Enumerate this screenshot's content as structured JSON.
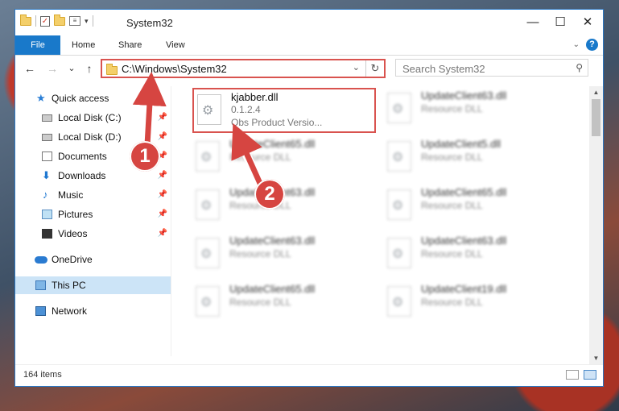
{
  "window": {
    "title": "System32",
    "controls": {
      "minimize": "—",
      "maximize": "☐",
      "close": "✕"
    }
  },
  "ribbon": {
    "tabs": [
      {
        "label": "File"
      },
      {
        "label": "Home"
      },
      {
        "label": "Share"
      },
      {
        "label": "View"
      }
    ],
    "help": "?"
  },
  "nav": {
    "back": "←",
    "forward": "→",
    "recent": "⌄",
    "up": "↑",
    "address": "C:\\Windows\\System32",
    "refresh": "↻",
    "search_placeholder": "Search System32"
  },
  "sidebar": {
    "items": [
      {
        "label": "Quick access",
        "icon": "star-icon"
      },
      {
        "label": "Local Disk (C:)",
        "icon": "disk-icon",
        "pinned": true
      },
      {
        "label": "Local Disk (D:)",
        "icon": "disk-icon",
        "pinned": true
      },
      {
        "label": "Documents",
        "icon": "documents-icon",
        "pinned": true
      },
      {
        "label": "Downloads",
        "icon": "downloads-icon",
        "pinned": true
      },
      {
        "label": "Music",
        "icon": "music-icon",
        "pinned": true
      },
      {
        "label": "Pictures",
        "icon": "pictures-icon",
        "pinned": true
      },
      {
        "label": "Videos",
        "icon": "videos-icon",
        "pinned": true
      },
      {
        "label": "OneDrive",
        "icon": "onedrive-icon"
      },
      {
        "label": "This PC",
        "icon": "pc-icon",
        "selected": true
      },
      {
        "label": "Network",
        "icon": "network-icon"
      }
    ]
  },
  "files": [
    {
      "name": "kjabber.dll",
      "line1": "0.1.2.4",
      "line2": "Obs   Product Versio...",
      "highlighted": true
    },
    {
      "name": "UpdateClient63.dll",
      "line1": "Resource DLL"
    },
    {
      "name": "UpdateClient65.dll",
      "line1": "Resource DLL"
    },
    {
      "name": "UpdateClient5.dll",
      "line1": "Resource DLL"
    },
    {
      "name": "UpdateClient63.dll",
      "line1": "Resource DLL"
    },
    {
      "name": "UpdateClient65.dll",
      "line1": "Resource DLL"
    },
    {
      "name": "UpdateClient63.dll",
      "line1": "Resource DLL"
    },
    {
      "name": "UpdateClient63.dll",
      "line1": "Resource DLL"
    },
    {
      "name": "UpdateClient65.dll",
      "line1": "Resource DLL"
    },
    {
      "name": "UpdateClient19.dll",
      "line1": "Resource DLL"
    }
  ],
  "status": {
    "items_count": "164 items"
  },
  "annotations": {
    "step1": "1",
    "step2": "2",
    "color": "#d64541"
  }
}
